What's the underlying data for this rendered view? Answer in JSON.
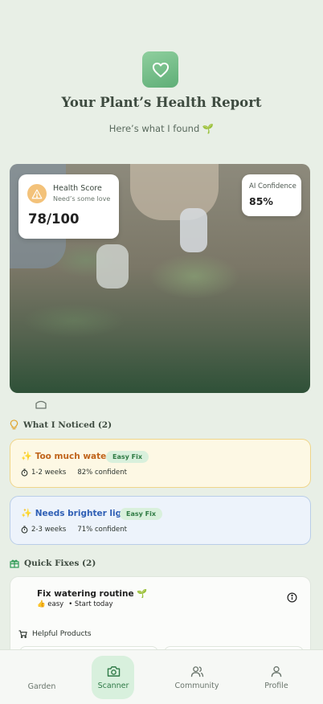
{
  "header": {
    "title": "Your Plant’s Health Report",
    "subtitle": "Here’s what I found 🌱"
  },
  "health_card": {
    "title": "Health Score",
    "subtitle": "Need’s some love",
    "score": "78/100"
  },
  "ai_card": {
    "title": "AI Confidence",
    "value": "85%"
  },
  "noticed": {
    "heading": "What I Noticed (2)",
    "items": [
      {
        "name": "Too much water",
        "badge": "Easy Fix",
        "duration": "1-2 weeks",
        "confidence": "82% confident"
      },
      {
        "name": "Needs brighter light",
        "badge": "Easy Fix",
        "duration": "2-3 weeks",
        "confidence": "71% confident"
      }
    ]
  },
  "quick_fixes": {
    "heading": "Quick Fixes (2)",
    "first": {
      "title": "Fix watering routine 🌱",
      "difficulty": "👍 easy",
      "timing": "• Start today"
    },
    "helpful_label": "Helpful Products"
  },
  "nav": {
    "items": [
      {
        "label": "Garden",
        "icon": "garden-icon"
      },
      {
        "label": "Scanner",
        "icon": "camera-icon"
      },
      {
        "label": "Community",
        "icon": "users-icon"
      },
      {
        "label": "Profile",
        "icon": "user-icon"
      }
    ],
    "active": "Scanner"
  },
  "colors": {
    "background": "#e8efe6",
    "accent": "#5fae77",
    "warning": "#f3c27a",
    "orange_text": "#c0641b",
    "blue_text": "#2f5fb5"
  }
}
